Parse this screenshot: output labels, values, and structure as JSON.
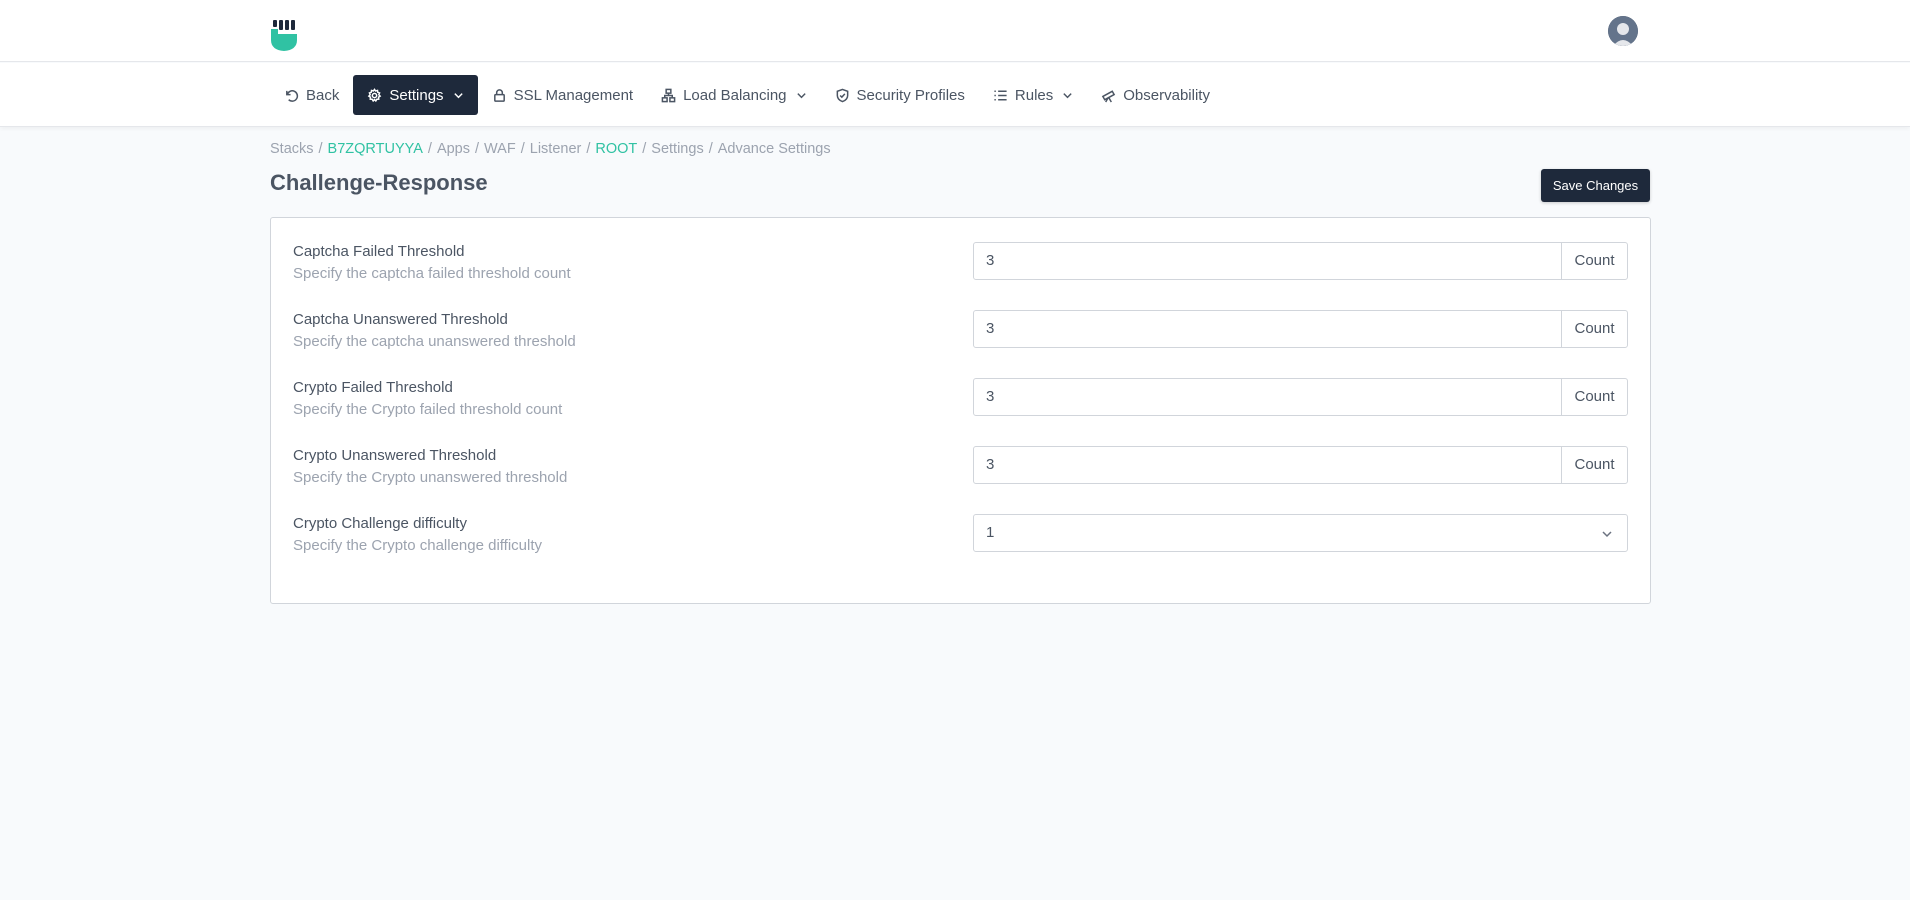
{
  "brand": {
    "accent": "#30c2a3",
    "dark": "#1e293b"
  },
  "nav": {
    "back": "Back",
    "settings": "Settings",
    "ssl": "SSL Management",
    "load_balancing": "Load Balancing",
    "security_profiles": "Security Profiles",
    "rules": "Rules",
    "observability": "Observability"
  },
  "breadcrumb": {
    "stacks": "Stacks",
    "stack_id": "B7ZQRTUYYA",
    "apps": "Apps",
    "waf": "WAF",
    "listener": "Listener",
    "root": "ROOT",
    "settings": "Settings",
    "advance": "Advance Settings",
    "separator": "/"
  },
  "page": {
    "title": "Challenge-Response",
    "save_label": "Save Changes"
  },
  "fields": [
    {
      "label": "Captcha Failed Threshold",
      "description": "Specify the captcha failed threshold count",
      "value": "3",
      "suffix": "Count"
    },
    {
      "label": "Captcha Unanswered Threshold",
      "description": "Specify the captcha unanswered threshold",
      "value": "3",
      "suffix": "Count"
    },
    {
      "label": "Crypto Failed Threshold",
      "description": "Specify the Crypto failed threshold count",
      "value": "3",
      "suffix": "Count"
    },
    {
      "label": "Crypto Unanswered Threshold",
      "description": "Specify the Crypto unanswered threshold",
      "value": "3",
      "suffix": "Count"
    },
    {
      "label": "Crypto Challenge difficulty",
      "description": "Specify the Crypto challenge difficulty",
      "value": "1"
    }
  ],
  "icons": {
    "logo": "fist-shield-logo",
    "avatar": "user-avatar",
    "back": "undo-icon",
    "settings": "gear-icon",
    "ssl": "lock-icon",
    "load_balancing": "network-icon",
    "security": "shield-icon",
    "rules": "list-icon",
    "observability": "telescope-icon"
  }
}
